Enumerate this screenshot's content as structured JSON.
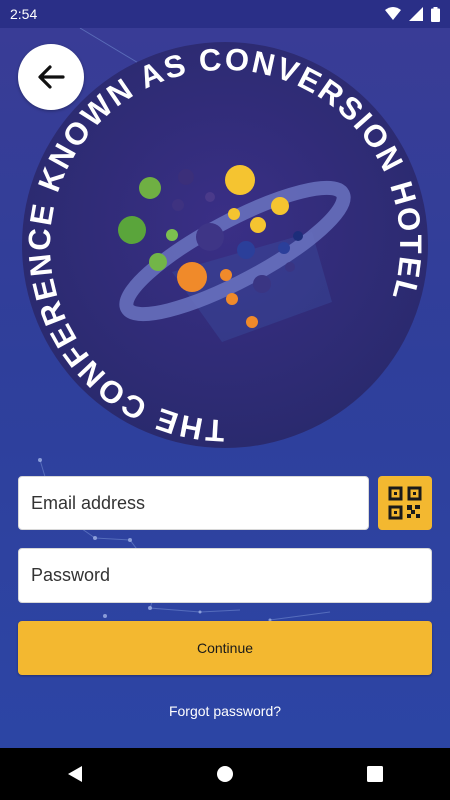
{
  "status_bar": {
    "time": "2:54",
    "icons": [
      "wifi-icon",
      "signal-icon",
      "battery-icon"
    ]
  },
  "header": {
    "back_icon": "arrow-left-icon"
  },
  "logo": {
    "ring_text": "THE CONFERENCE KNOWN AS CONVERSION HOTEL",
    "separator": "⌐",
    "colors": {
      "badge": "#2d2b72",
      "planet_orange": "#f08a2a",
      "planet_yellow": "#f5c430",
      "planet_green": "#6fb043"
    }
  },
  "form": {
    "email_placeholder": "Email address",
    "password_placeholder": "Password",
    "qr_icon": "qr-code-icon",
    "continue_label": "Continue",
    "forgot_label": "Forgot password?"
  },
  "colors": {
    "accent": "#f3b830",
    "background": "#303e9c"
  },
  "nav_bar": {
    "icons": [
      "back-triangle-icon",
      "home-circle-icon",
      "recents-square-icon"
    ]
  }
}
